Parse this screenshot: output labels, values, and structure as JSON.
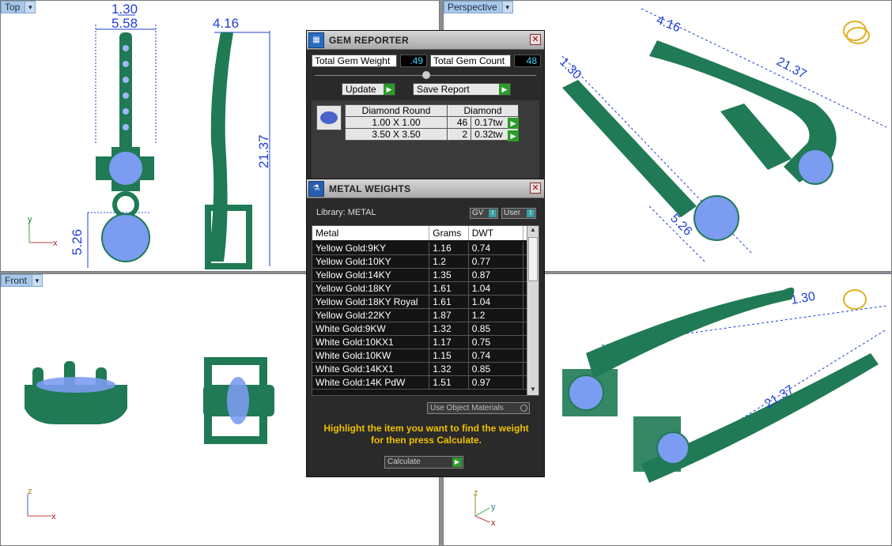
{
  "viewports": {
    "top": {
      "label": "Top"
    },
    "perspective": {
      "label": "Perspective"
    },
    "front": {
      "label": "Front"
    },
    "bottom_right": {
      "label": ""
    }
  },
  "dimensions": {
    "top_width_a": "1.30",
    "top_width_b": "5.58",
    "side_width": "4.16",
    "length": "21.37",
    "stone_height": "5.26",
    "persp_a": "4.16",
    "persp_b": "21.37",
    "persp_c": "1.30",
    "persp_d": "5.26",
    "br_a": "1.30",
    "br_b": "21.37"
  },
  "axes": {
    "x": "x",
    "y": "y",
    "z": "z"
  },
  "gem_reporter": {
    "title": "GEM REPORTER",
    "total_weight_label": "Total Gem Weight",
    "total_weight_value": ".49",
    "total_count_label": "Total Gem Count",
    "total_count_value": "48",
    "update_label": "Update",
    "save_label": "Save Report",
    "table": {
      "header": [
        "Diamond Round",
        "Diamond"
      ],
      "rows": [
        {
          "size": "1.00 X 1.00",
          "count": "46",
          "weight": "0.17tw"
        },
        {
          "size": "3.50 X 3.50",
          "count": "2",
          "weight": "0.32tw"
        }
      ]
    }
  },
  "metal_weights": {
    "title": "METAL WEIGHTS",
    "library_label": "Library: METAL",
    "gv_label": "GV",
    "user_label": "User",
    "columns": [
      "Metal",
      "Grams",
      "DWT"
    ],
    "rows": [
      {
        "metal": "Yellow Gold:9KY",
        "grams": "1.16",
        "dwt": "0.74"
      },
      {
        "metal": "Yellow Gold:10KY",
        "grams": "1.2",
        "dwt": "0.77"
      },
      {
        "metal": "Yellow Gold:14KY",
        "grams": "1.35",
        "dwt": "0.87"
      },
      {
        "metal": "Yellow Gold:18KY",
        "grams": "1.61",
        "dwt": "1.04"
      },
      {
        "metal": "Yellow Gold:18KY Royal",
        "grams": "1.61",
        "dwt": "1.04"
      },
      {
        "metal": "Yellow Gold:22KY",
        "grams": "1.87",
        "dwt": "1.2"
      },
      {
        "metal": "White Gold:9KW",
        "grams": "1.32",
        "dwt": "0.85"
      },
      {
        "metal": "White Gold:10KX1",
        "grams": "1.17",
        "dwt": "0.75"
      },
      {
        "metal": "White Gold:10KW",
        "grams": "1.15",
        "dwt": "0.74"
      },
      {
        "metal": "White Gold:14KX1",
        "grams": "1.32",
        "dwt": "0.85"
      },
      {
        "metal": "White Gold:14K PdW",
        "grams": "1.51",
        "dwt": "0.97"
      }
    ],
    "use_object_materials": "Use Object Materials",
    "hint": "Highlight the item you want to find the weight for then press Calculate.",
    "calculate_label": "Calculate"
  },
  "colors": {
    "model": "#1f7a55",
    "stone": "#7b9cf0",
    "dim_line": "#1f3fd6",
    "hint": "#f0c000"
  }
}
